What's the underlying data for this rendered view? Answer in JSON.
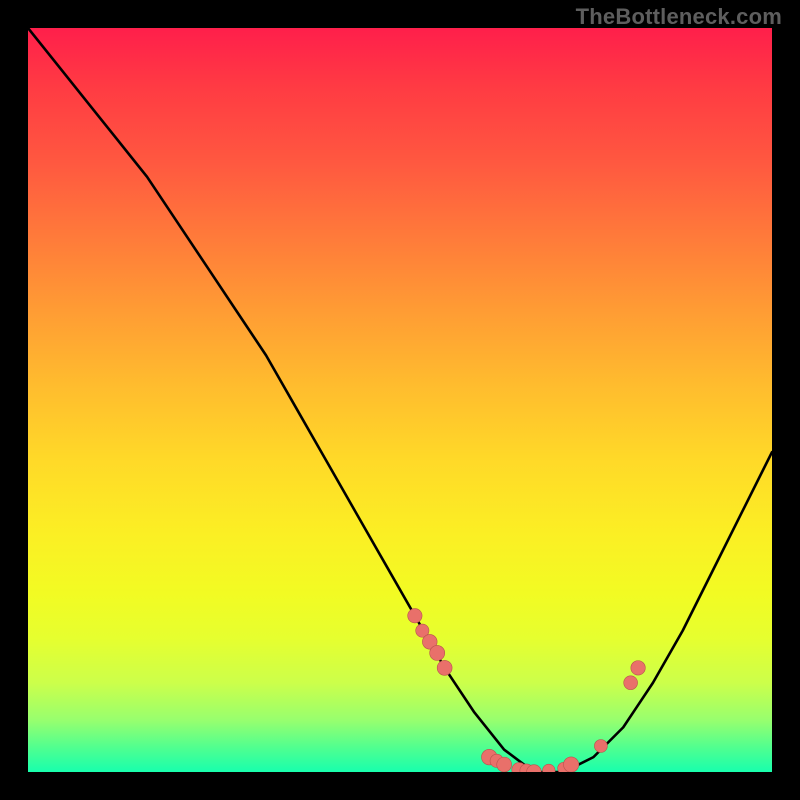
{
  "watermark": "TheBottleneck.com",
  "colors": {
    "gradient_top": "#ff1f4b",
    "gradient_bottom": "#18ffad",
    "curve": "#000000",
    "marker_fill": "#e9706a",
    "marker_stroke": "#b9534e",
    "background": "#000000"
  },
  "chart_data": {
    "type": "line",
    "title": "",
    "xlabel": "",
    "ylabel": "",
    "xlim": [
      0,
      100
    ],
    "ylim": [
      0,
      100
    ],
    "grid": false,
    "legend": false,
    "series": [
      {
        "name": "bottleneck-curve",
        "x": [
          0,
          4,
          8,
          12,
          16,
          20,
          24,
          28,
          32,
          36,
          40,
          44,
          48,
          52,
          56,
          60,
          64,
          68,
          72,
          76,
          80,
          84,
          88,
          92,
          96,
          100
        ],
        "y": [
          100,
          95,
          90,
          85,
          80,
          74,
          68,
          62,
          56,
          49,
          42,
          35,
          28,
          21,
          14,
          8,
          3,
          0,
          0,
          2,
          6,
          12,
          19,
          27,
          35,
          43
        ]
      }
    ],
    "markers": {
      "name": "highlighted-points",
      "x": [
        52,
        53,
        54,
        55,
        56,
        62,
        63,
        64,
        66,
        67,
        68,
        70,
        72,
        73,
        77,
        81,
        82
      ],
      "y": [
        21,
        19,
        17.5,
        16,
        14,
        2,
        1.5,
        1,
        0.3,
        0.2,
        0,
        0.2,
        0.5,
        1,
        3.5,
        12,
        14
      ]
    }
  }
}
